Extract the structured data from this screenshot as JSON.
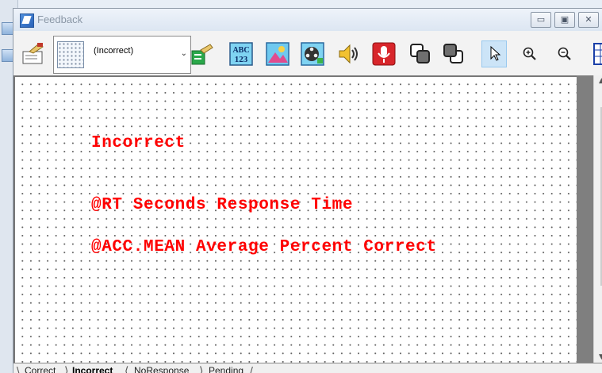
{
  "window": {
    "title": "Feedback"
  },
  "window_controls": {
    "minimize": "▭",
    "maximize": "▣",
    "close": "✕"
  },
  "toolbar": {
    "selected_state": "(Incorrect)",
    "dropdown_arrow": "⌄",
    "icons": [
      "properties-icon",
      "state-dropdown",
      "add-state-icon",
      "text-display-icon",
      "image-display-icon",
      "movie-display-icon",
      "sound-out-icon",
      "sound-in-icon",
      "bring-to-front-icon",
      "send-to-back-icon",
      "select-tool-icon",
      "zoom-in-icon",
      "zoom-out-icon",
      "grid-icon"
    ]
  },
  "canvas": {
    "lines": [
      "Incorrect",
      "@RT Seconds Response Time",
      "@ACC.MEAN Average Percent Correct"
    ],
    "text_color": "#ff0000"
  },
  "tabs": [
    {
      "label": "Correct",
      "active": false
    },
    {
      "label": "Incorrect",
      "active": true
    },
    {
      "label": "NoResponse",
      "active": false
    },
    {
      "label": "Pending",
      "active": false
    }
  ]
}
